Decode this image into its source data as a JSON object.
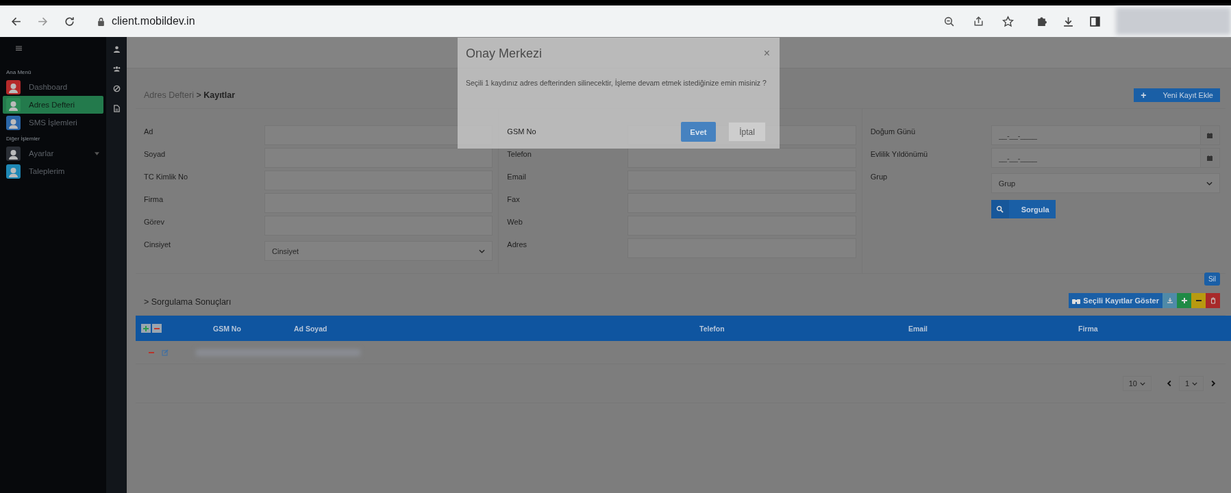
{
  "browser": {
    "url": "client.mobildev.in"
  },
  "sidebar": {
    "sections": [
      {
        "heading": "Ana Menü",
        "items": [
          {
            "label": "Dashboard",
            "color": "#b52a2a",
            "selected": false,
            "expandable": false
          },
          {
            "label": "Adres Defteri",
            "color": "#2b8a55",
            "selected": true,
            "expandable": false
          },
          {
            "label": "SMS İşlemleri",
            "color": "#2a66a8",
            "selected": false,
            "expandable": false
          }
        ]
      },
      {
        "heading": "Diğer İşlemler",
        "items": [
          {
            "label": "Ayarlar",
            "color": "#2a2e35",
            "selected": false,
            "expandable": true
          },
          {
            "label": "Taleplerim",
            "color": "#1e88b5",
            "selected": false,
            "expandable": false
          }
        ]
      }
    ]
  },
  "breadcrumb": {
    "parent": "Adres Defteri",
    "separator": ">",
    "current": "Kayıtlar"
  },
  "new_button": "Yeni Kayıt Ekle",
  "new_button_icon": "+",
  "form": {
    "columns": [
      [
        {
          "label": "Ad",
          "kind": "text"
        },
        {
          "label": "Soyad",
          "kind": "text"
        },
        {
          "label": "TC Kimlik No",
          "kind": "text"
        },
        {
          "label": "Firma",
          "kind": "text"
        },
        {
          "label": "Görev",
          "kind": "text"
        },
        {
          "label": "Cinsiyet",
          "kind": "select",
          "value": "Cinsiyet"
        }
      ],
      [
        {
          "label": "GSM No",
          "kind": "text"
        },
        {
          "label": "Telefon",
          "kind": "text"
        },
        {
          "label": "Email",
          "kind": "text"
        },
        {
          "label": "Fax",
          "kind": "text"
        },
        {
          "label": "Web",
          "kind": "text"
        },
        {
          "label": "Adres",
          "kind": "text"
        }
      ],
      [
        {
          "label": "Doğum Günü",
          "kind": "date",
          "placeholder": "__-__-____"
        },
        {
          "label": "Evlilik Yıldönümü",
          "kind": "date",
          "placeholder": "__-__-____"
        },
        {
          "label": "Grup",
          "kind": "select",
          "value": "Grup"
        }
      ]
    ]
  },
  "search_button": "Sorgula",
  "results": {
    "toggle": ">",
    "title": "Sorgulama Sonuçları",
    "show_selected_button": "Seçili Kayıtlar Göster",
    "tooltip": "Sil",
    "columns": [
      "GSM No",
      "Ad Soyad",
      "Telefon",
      "Email",
      "Firma"
    ],
    "page_size": "10",
    "page": "1"
  },
  "modal": {
    "title": "Onay Merkezi",
    "close": "×",
    "message": "Seçili 1 kaydınız adres defterinden silinecektir, İşleme devam etmek istediğinize emin misiniz ?",
    "confirm": "Evet",
    "cancel": "İptal"
  }
}
